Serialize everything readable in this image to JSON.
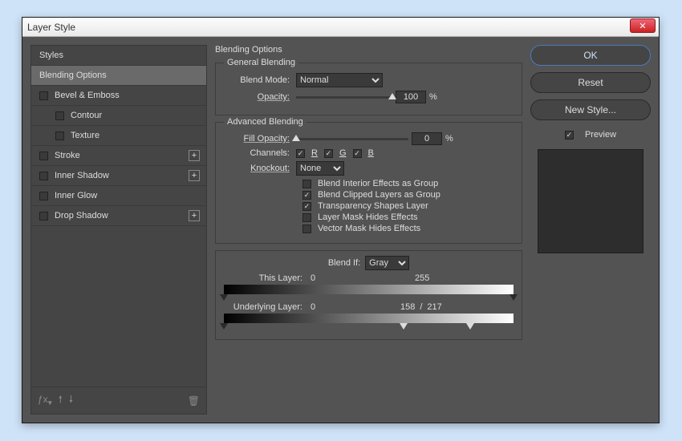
{
  "window": {
    "title": "Layer Style"
  },
  "styles": {
    "header": "Styles",
    "items": [
      {
        "label": "Blending Options",
        "selected": true,
        "checkbox": false,
        "indent": false,
        "plus": false
      },
      {
        "label": "Bevel & Emboss",
        "selected": false,
        "checkbox": true,
        "checked": false,
        "indent": false,
        "plus": false
      },
      {
        "label": "Contour",
        "selected": false,
        "checkbox": true,
        "checked": false,
        "indent": true,
        "plus": false
      },
      {
        "label": "Texture",
        "selected": false,
        "checkbox": true,
        "checked": false,
        "indent": true,
        "plus": false
      },
      {
        "label": "Stroke",
        "selected": false,
        "checkbox": true,
        "checked": false,
        "indent": false,
        "plus": true
      },
      {
        "label": "Inner Shadow",
        "selected": false,
        "checkbox": true,
        "checked": false,
        "indent": false,
        "plus": true
      },
      {
        "label": "Inner Glow",
        "selected": false,
        "checkbox": true,
        "checked": false,
        "indent": false,
        "plus": false
      },
      {
        "label": "Drop Shadow",
        "selected": false,
        "checkbox": true,
        "checked": false,
        "indent": false,
        "plus": true
      }
    ]
  },
  "blending": {
    "title": "Blending Options",
    "general": {
      "legend": "General Blending",
      "mode_label": "Blend Mode:",
      "mode_value": "Normal",
      "opacity_label": "Opacity:",
      "opacity_value": "100",
      "opacity_unit": "%"
    },
    "advanced": {
      "legend": "Advanced Blending",
      "fill_label": "Fill Opacity:",
      "fill_value": "0",
      "fill_unit": "%",
      "channels_label": "Channels:",
      "ch_r": "R",
      "ch_g": "G",
      "ch_b": "B",
      "knockout_label": "Knockout:",
      "knockout_value": "None",
      "opts": {
        "interior": "Blend Interior Effects as Group",
        "clipped": "Blend Clipped Layers as Group",
        "transparency": "Transparency Shapes Layer",
        "layermask": "Layer Mask Hides Effects",
        "vectormask": "Vector Mask Hides Effects"
      },
      "checks": {
        "interior": false,
        "clipped": true,
        "transparency": true,
        "layermask": false,
        "vectormask": false
      }
    },
    "blendif": {
      "label": "Blend If:",
      "value": "Gray",
      "this_label": "This Layer:",
      "this_low": "0",
      "this_high": "255",
      "under_label": "Underlying Layer:",
      "under_low": "0",
      "under_mid": "158",
      "under_sep": "/",
      "under_high": "217"
    }
  },
  "side": {
    "ok": "OK",
    "reset": "Reset",
    "newstyle": "New Style...",
    "preview": "Preview"
  }
}
